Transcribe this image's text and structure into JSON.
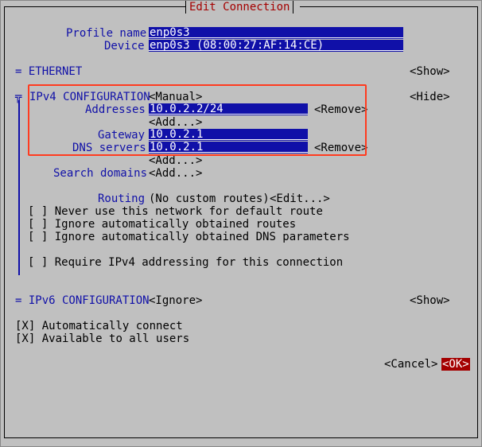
{
  "dialog": {
    "title": "Edit Connection"
  },
  "profile": {
    "name_label": "Profile name",
    "name_value": "enp0s3",
    "device_label": "Device",
    "device_value": "enp0s3 (08:00:27:AF:14:CE)"
  },
  "ethernet": {
    "label": "= ETHERNET",
    "toggle": "<Show>"
  },
  "ipv4": {
    "marker": "╦",
    "label": "IPv4 CONFIGURATION",
    "method": "<Manual>",
    "toggle": "<Hide>",
    "addresses_label": "Addresses",
    "addresses_value": "10.0.2.2/24",
    "remove_label": "<Remove>",
    "add_label": "<Add...>",
    "gateway_label": "Gateway",
    "gateway_value": "10.0.2.1",
    "dns_label": "DNS servers",
    "dns_value": "10.0.2.1",
    "search_label": "Search domains",
    "routing_label": "Routing",
    "routing_value": "(No custom routes)",
    "edit_label": "<Edit...>",
    "checkboxes": [
      {
        "mark": "[ ]",
        "label": "Never use this network for default route"
      },
      {
        "mark": "[ ]",
        "label": "Ignore automatically obtained routes"
      },
      {
        "mark": "[ ]",
        "label": "Ignore automatically obtained DNS parameters"
      },
      {
        "mark": "[ ]",
        "label": "Require IPv4 addressing for this connection"
      }
    ]
  },
  "ipv6": {
    "label": "= IPv6 CONFIGURATION",
    "method": "<Ignore>",
    "toggle": "<Show>"
  },
  "general": [
    {
      "mark": "[X]",
      "label": "Automatically connect"
    },
    {
      "mark": "[X]",
      "label": "Available to all users"
    }
  ],
  "buttons": {
    "cancel": "<Cancel>",
    "ok": "<OK>"
  },
  "colors": {
    "background": "#c0c0c0",
    "label": "#1010a8",
    "field": "#1010a8",
    "title": "#a40000",
    "highlight": "#ff3b1f"
  }
}
